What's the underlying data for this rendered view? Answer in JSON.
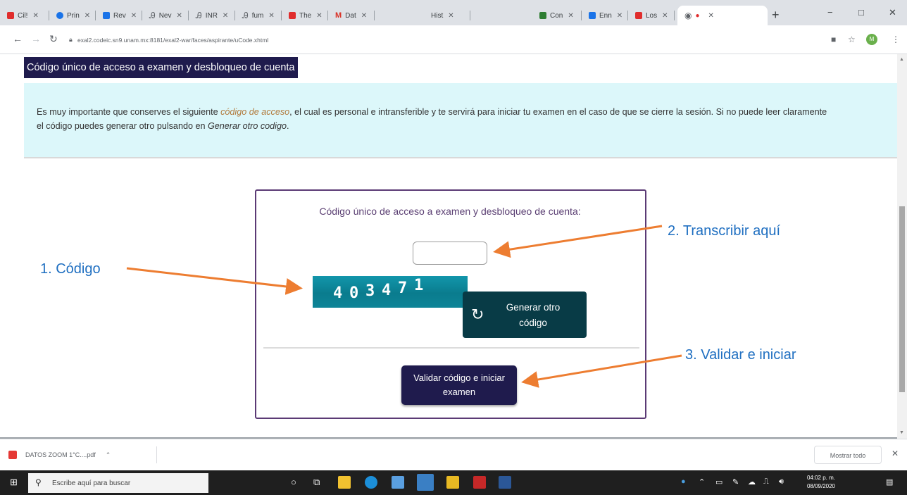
{
  "browser": {
    "tabs": [
      {
        "label": "Cil!",
        "color": "#e02d2d"
      },
      {
        "label": "Prin",
        "color": "#1a73e8"
      },
      {
        "label": "Rev",
        "color": "#1a73e8"
      },
      {
        "label": "Nev",
        "color": "#5f6368"
      },
      {
        "label": "INR",
        "color": "#5f6368"
      },
      {
        "label": "fum",
        "color": "#5f6368"
      },
      {
        "label": "The",
        "color": "#e02d2d"
      },
      {
        "label": "Dat",
        "color": "#d93025"
      },
      {
        "label": "Hist",
        "color": "#5f6368"
      },
      {
        "label": "Con",
        "color": "#2e7d32"
      },
      {
        "label": "Enn",
        "color": "#1a73e8"
      },
      {
        "label": "Los",
        "color": "#e02d2d"
      },
      {
        "label": "",
        "color": "#5f6368"
      }
    ],
    "new_tab": "+",
    "minimize": "−",
    "maximize": "□",
    "close": "✕",
    "url": "exal2.codeic.sn9.unam.mx:8181/exal2-war/faces/aspirante/uCode.xhtml",
    "profile_initial": "M"
  },
  "page": {
    "header_title": "Código único de acceso a examen y desbloqueo de cuenta",
    "info": {
      "text1": "Es muy importante que conserves el siguiente ",
      "code_phrase": "código de acceso",
      "text2": ", el cual es personal e intransferible y te servirá para iniciar tu examen en el caso de que se cierre la sesión. Si no puede leer claramente el código puedes generar otro pulsando en ",
      "generate_phrase": "Generar otro codigo",
      "text3": "."
    },
    "card": {
      "title": "Código único de acceso a examen y desbloqueo de cuenta:",
      "code_input_value": "",
      "captcha_digits": [
        "4",
        "0",
        "3",
        "4",
        "7",
        "1"
      ],
      "regenerate_label": "Generar otro código",
      "validate_label": "Validar código e iniciar examen"
    },
    "annotations": {
      "step1": "1. Código",
      "step2": "2. Transcribir aquí",
      "step3": "3. Validar e iniciar",
      "arrow_color": "#ed7d31",
      "label_color": "#1f6fc1"
    }
  },
  "download_bar": {
    "file_name": "DATOS ZOOM 1°C....pdf",
    "show_all": "Mostrar todo",
    "close": "✕"
  },
  "taskbar": {
    "search_placeholder": "Escribe aquí para buscar",
    "time": "04:02 p. m.",
    "date": "08/09/2020"
  }
}
